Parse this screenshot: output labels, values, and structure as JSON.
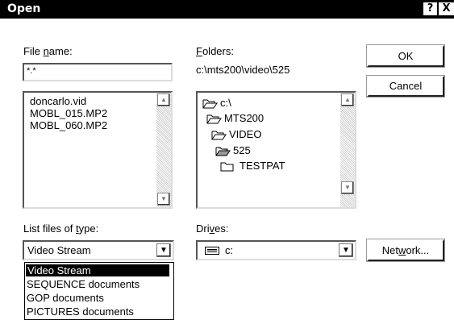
{
  "window": {
    "title": "Open",
    "help_label": "?",
    "close_label": "X"
  },
  "file_name": {
    "label_pre": "File ",
    "label_hot": "n",
    "label_post": "ame:",
    "value": "*.*",
    "files": [
      "doncarlo.vid",
      "MOBL_015.MP2",
      "MOBL_060.MP2"
    ]
  },
  "folders": {
    "label_hot": "F",
    "label_post": "olders:",
    "current_path": "c:\\mts200\\video\\525",
    "tree": [
      "c:\\",
      "MTS200",
      "VIDEO",
      "525",
      "TESTPAT"
    ]
  },
  "file_type": {
    "label_pre": "List files of ",
    "label_hot": "t",
    "label_post": "ype:",
    "selected": "Video Stream",
    "options": [
      "Video Stream",
      "SEQUENCE documents",
      "GOP documents",
      "PICTURES documents"
    ]
  },
  "drives": {
    "label_pre": "Dri",
    "label_hot": "v",
    "label_post": "es:",
    "selected": "c:"
  },
  "buttons": {
    "ok": "OK",
    "cancel": "Cancel",
    "network_pre": "Net",
    "network_hot": "w",
    "network_post": "ork..."
  }
}
